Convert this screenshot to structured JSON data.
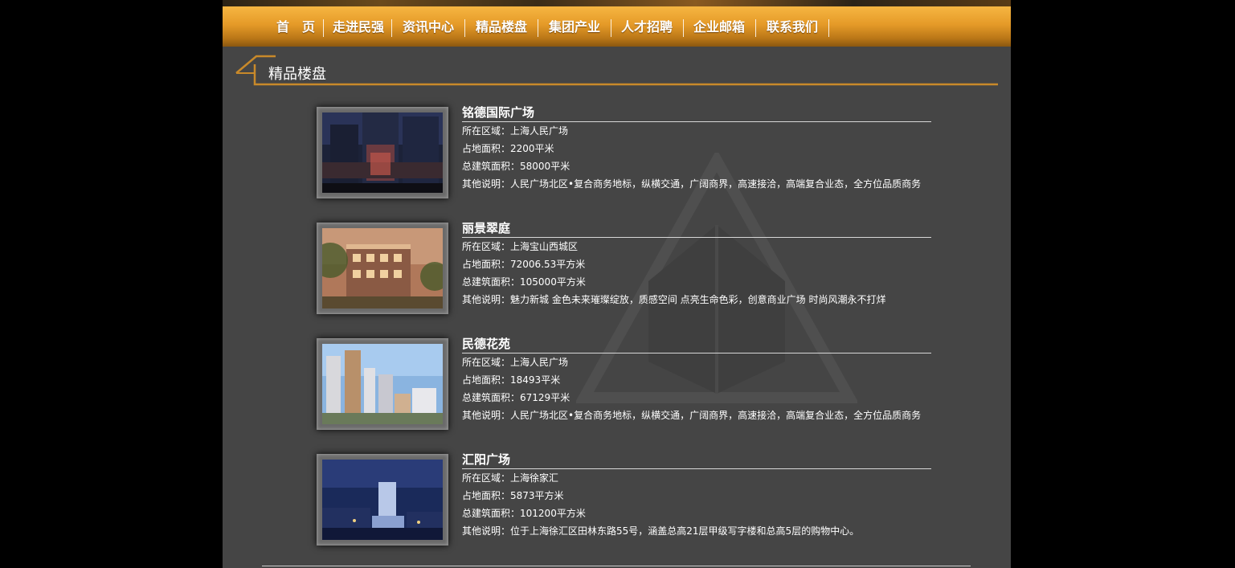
{
  "nav": {
    "items": [
      "首　页",
      "走进民强",
      "资讯中心",
      "精品楼盘",
      "集团产业",
      "人才招聘",
      "企业邮箱",
      "联系我们"
    ]
  },
  "section": {
    "title": "精品楼盘"
  },
  "labels": {
    "area": "所在区域：",
    "land": "占地面积：",
    "build": "总建筑面积：",
    "note": "其他说明："
  },
  "projects": [
    {
      "name": "铭德国际广场",
      "area": "上海人民广场",
      "land": "2200平米",
      "build": "58000平米",
      "note": "人民广场北区•复合商务地标，纵横交通，广阔商界，高速接洽，高端复合业态，全方位品质商务"
    },
    {
      "name": "丽景翠庭",
      "area": "上海宝山西城区",
      "land": "72006.53平方米",
      "build": "105000平方米",
      "note": "魅力新城 金色未来璀璨绽放，质感空间 点亮生命色彩，创意商业广场 时尚风潮永不打烊"
    },
    {
      "name": "民德花苑",
      "area": "上海人民广场",
      "land": "18493平米",
      "build": "67129平米",
      "note": "人民广场北区•复合商务地标，纵横交通，广阔商界，高速接洽，高端复合业态，全方位品质商务"
    },
    {
      "name": "汇阳广场",
      "area": "上海徐家汇",
      "land": "5873平方米",
      "build": "101200平方米",
      "note": "位于上海徐汇区田林东路55号，涵盖总高21层甲级写字楼和总高5层的购物中心。"
    }
  ],
  "colors": {
    "accent": "#c8892a",
    "nav_top": "#f6b642",
    "nav_bottom": "#8a5710",
    "panel": "#454545"
  }
}
